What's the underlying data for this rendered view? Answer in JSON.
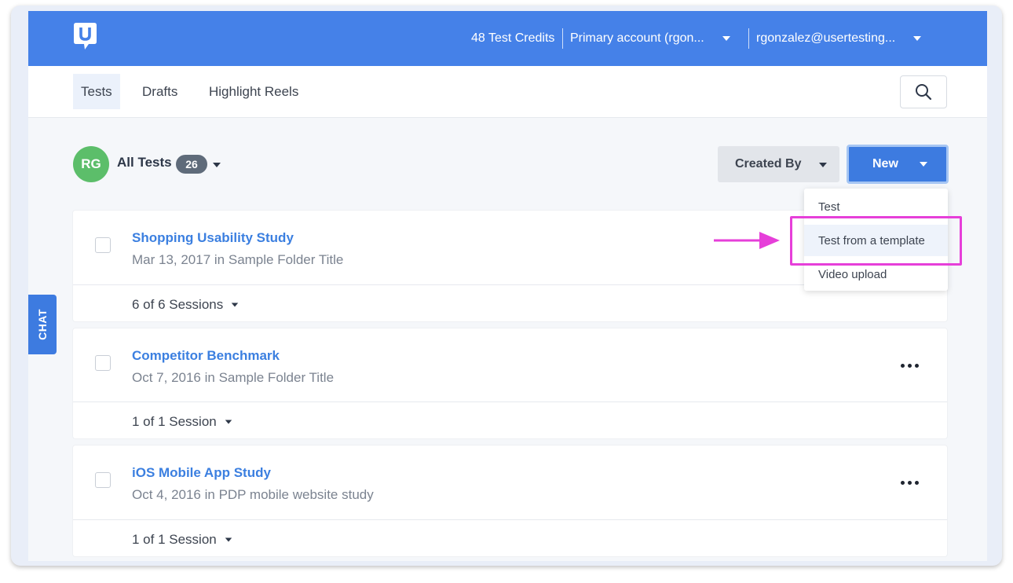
{
  "header": {
    "credits": "48 Test Credits",
    "account": "Primary account (rgon...",
    "user": "rgonzalez@usertesting..."
  },
  "tabs": [
    {
      "label": "Tests",
      "active": true
    },
    {
      "label": "Drafts",
      "active": false
    },
    {
      "label": "Highlight Reels",
      "active": false
    }
  ],
  "toolbar": {
    "avatar_initials": "RG",
    "all_tests_label": "All Tests",
    "count": "26",
    "created_by_label": "Created By",
    "new_label": "New"
  },
  "new_menu": {
    "items": [
      "Test",
      "Test from a template",
      "Video upload"
    ],
    "highlighted": "Test from a template"
  },
  "chat_label": "CHAT",
  "tests": [
    {
      "title": "Shopping Usability Study",
      "meta": "Mar 13, 2017 in Sample Folder Title",
      "sessions": "6 of 6 Sessions"
    },
    {
      "title": "Competitor Benchmark",
      "meta": "Oct 7, 2016 in Sample Folder Title",
      "sessions": "1 of 1 Session"
    },
    {
      "title": "iOS Mobile App Study",
      "meta": "Oct 4, 2016 in PDP mobile website study",
      "sessions": "1 of 1 Session"
    }
  ],
  "colors": {
    "brand_blue": "#4581e8",
    "link_blue": "#3b7fe0",
    "avatar_green": "#5cbe6a",
    "highlight_magenta": "#e63fd9"
  }
}
